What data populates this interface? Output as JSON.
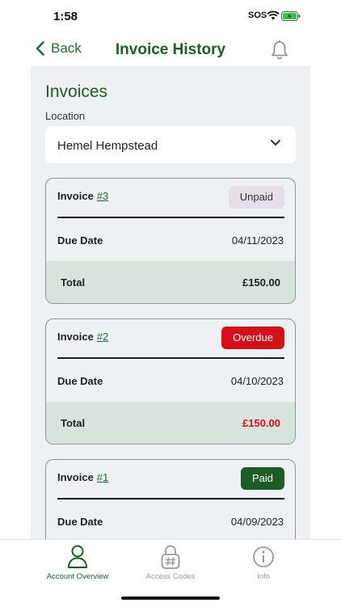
{
  "status_bar": {
    "time": "1:58",
    "carrier": "SOS"
  },
  "nav": {
    "back_label": "Back",
    "title": "Invoice History"
  },
  "section": {
    "title": "Invoices",
    "location_label": "Location",
    "location_value": "Hemel Hempstead"
  },
  "invoices": [
    {
      "label": "Invoice",
      "number": "#3",
      "status": "Unpaid",
      "due_label": "Due Date",
      "due_date": "04/11/2023",
      "total_label": "Total",
      "total": "£150.00"
    },
    {
      "label": "Invoice",
      "number": "#2",
      "status": "Overdue",
      "due_label": "Due Date",
      "due_date": "04/10/2023",
      "total_label": "Total",
      "total": "£150.00"
    },
    {
      "label": "Invoice",
      "number": "#1",
      "status": "Paid",
      "due_label": "Due Date",
      "due_date": "04/09/2023",
      "total_label": "Total",
      "total": ""
    }
  ],
  "tabs": [
    {
      "label": "Account Overview",
      "icon": "person-icon",
      "active": true
    },
    {
      "label": "Access Codes",
      "icon": "lock-hash-icon",
      "active": false
    },
    {
      "label": "Info",
      "icon": "info-icon",
      "active": false
    }
  ],
  "colors": {
    "brand": "#1d5c27",
    "unpaid_bg": "#e6dfe9",
    "overdue": "#d4101b",
    "paid": "#1d5c27",
    "total_row": "#d9e3de"
  }
}
